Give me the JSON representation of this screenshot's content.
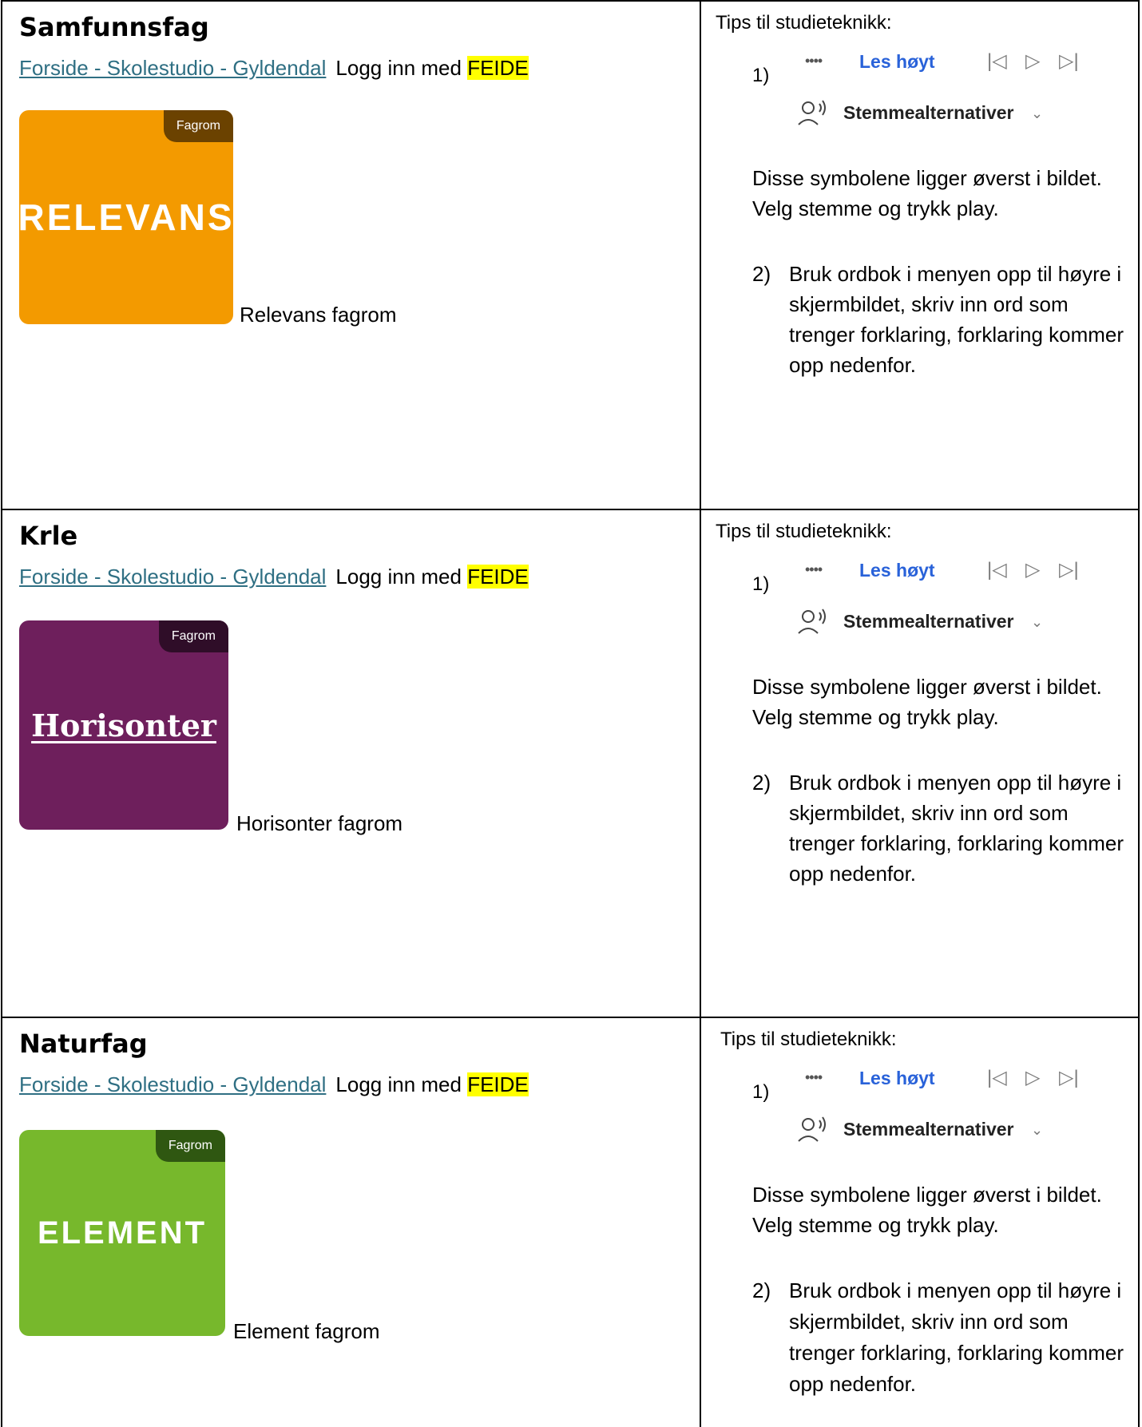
{
  "rows": [
    {
      "subject": "Samfunnsfag",
      "link_text": "Forside - Skolestudio - Gyldendal",
      "login_text": "Logg inn med",
      "feide": "FEIDE",
      "logo": {
        "badge": "Fagrom",
        "word": "RELEVANS",
        "bg": "#f39a00",
        "badge_bg": "#6b4200"
      },
      "caption": "Relevans fagrom",
      "tips": {
        "heading": "Tips til studieteknikk:",
        "step1_num": "1)",
        "dots": "••••",
        "read_aloud": "Les høyt",
        "prev": "|◁",
        "play": "▷",
        "next": "▷|",
        "voice_options": "Stemmealternativer",
        "chevron": "⌄",
        "description": "Disse symbolene ligger øverst i bildet. Velg stemme og trykk play.",
        "step2_num": "2)",
        "step2_text": "Bruk ordbok i menyen opp til høyre i skjermbildet, skriv inn ord som trenger forklaring, forklaring kommer opp nedenfor."
      }
    },
    {
      "subject": "Krle",
      "link_text": "Forside - Skolestudio - Gyldendal",
      "login_text": "Logg inn med",
      "feide": "FEIDE",
      "logo": {
        "badge": "Fagrom",
        "word": "Horisonter",
        "bg": "#6e1f5c",
        "badge_bg": "#2f0d28"
      },
      "caption": "Horisonter fagrom",
      "tips": {
        "heading": "Tips til studieteknikk:",
        "step1_num": "1)",
        "dots": "••••",
        "read_aloud": "Les høyt",
        "prev": "|◁",
        "play": "▷",
        "next": "▷|",
        "voice_options": "Stemmealternativer",
        "chevron": "⌄",
        "description": "Disse symbolene ligger øverst i bildet. Velg stemme og trykk play.",
        "step2_num": "2)",
        "step2_text": "Bruk ordbok i menyen opp til høyre i skjermbildet, skriv inn ord som trenger forklaring, forklaring kommer opp nedenfor."
      }
    },
    {
      "subject": "Naturfag",
      "link_text": "Forside - Skolestudio - Gyldendal",
      "login_text": "Logg inn med",
      "feide": "FEIDE",
      "logo": {
        "badge": "Fagrom",
        "word": "ELEMENT",
        "bg": "#77b82c",
        "badge_bg": "#2f5711"
      },
      "caption": "Element fagrom",
      "tips": {
        "heading": "Tips til studieteknikk:",
        "step1_num": "1)",
        "dots": "••••",
        "read_aloud": "Les høyt",
        "prev": "|◁",
        "play": "▷",
        "next": "▷|",
        "voice_options": "Stemmealternativer",
        "chevron": "⌄",
        "description": "Disse symbolene ligger øverst i bildet. Velg stemme og trykk play.",
        "step2_num": "2)",
        "step2_text": "Bruk ordbok i menyen opp til høyre i skjermbildet, skriv inn ord som trenger forklaring, forklaring kommer opp nedenfor."
      }
    }
  ]
}
